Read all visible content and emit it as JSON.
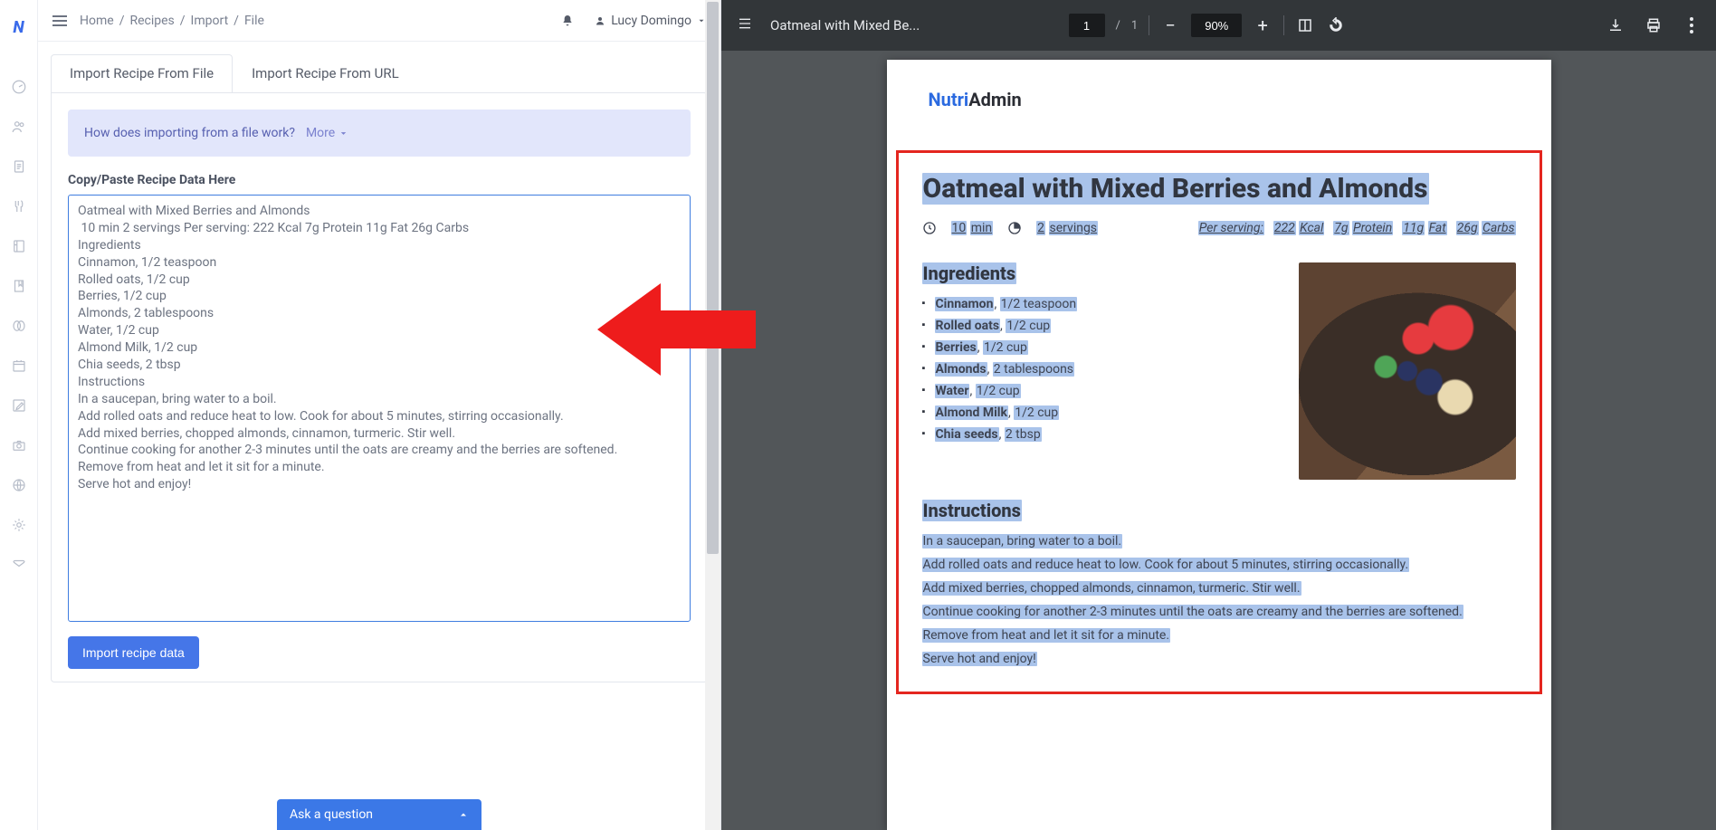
{
  "breadcrumb": [
    "Home",
    "Recipes",
    "Import",
    "File"
  ],
  "user_name": "Lucy Domingo",
  "tabs": {
    "file": "Import Recipe From File",
    "url": "Import Recipe From URL"
  },
  "banner": {
    "text": "How does importing from a file work?",
    "more": "More"
  },
  "paste_label": "Copy/Paste Recipe Data Here",
  "paste_value": "Oatmeal with Mixed Berries and Almonds\n 10 min 2 servings Per serving: 222 Kcal 7g Protein 11g Fat 26g Carbs\nIngredients\nCinnamon, 1/2 teaspoon\nRolled oats, 1/2 cup\nBerries, 1/2 cup\nAlmonds, 2 tablespoons\nWater, 1/2 cup\nAlmond Milk, 1/2 cup\nChia seeds, 2 tbsp\nInstructions\nIn a saucepan, bring water to a boil.\nAdd rolled oats and reduce heat to low. Cook for about 5 minutes, stirring occasionally.\nAdd mixed berries, chopped almonds, cinnamon, turmeric. Stir well.\nContinue cooking for another 2-3 minutes until the oats are creamy and the berries are softened.\nRemove from heat and let it sit for a minute.\nServe hot and enjoy!\n",
  "import_button": "Import recipe data",
  "ask_button": "Ask a question",
  "pdf": {
    "title": "Oatmeal with Mixed Be...",
    "page_current": "1",
    "page_total": "1",
    "zoom": "90%",
    "brand_a": "Nutri",
    "brand_b": "Admin"
  },
  "recipe": {
    "title": "Oatmeal with Mixed Berries and Almonds",
    "time_n": "10",
    "time_u": "min",
    "serv_n": "2",
    "serv_u": "servings",
    "per_label": "Per serving:",
    "kcal_n": "222",
    "kcal_u": "Kcal",
    "prot_n": "7g",
    "prot_u": "Protein",
    "fat_n": "11g",
    "fat_u": "Fat",
    "carb_n": "26g",
    "carb_u": "Carbs",
    "ingredients_head": "Ingredients",
    "ingredients": [
      {
        "name": "Cinnamon",
        "qty": "1/2 teaspoon"
      },
      {
        "name": "Rolled oats",
        "qty": "1/2 cup"
      },
      {
        "name": "Berries",
        "qty": "1/2 cup"
      },
      {
        "name": "Almonds",
        "qty": "2 tablespoons"
      },
      {
        "name": "Water",
        "qty": "1/2 cup"
      },
      {
        "name": "Almond Milk",
        "qty": "1/2 cup"
      },
      {
        "name": "Chia seeds",
        "qty": "2 tbsp"
      }
    ],
    "instructions_head": "Instructions",
    "instructions": [
      "In a saucepan, bring water to a boil.",
      "Add rolled oats and reduce heat to low. Cook for about 5 minutes, stirring occasionally.",
      "Add mixed berries, chopped almonds, cinnamon, turmeric. Stir well.",
      "Continue cooking for another 2-3 minutes until the oats are creamy and the berries are softened.",
      "Remove from heat and let it sit for a minute.",
      "Serve hot and enjoy!"
    ]
  }
}
